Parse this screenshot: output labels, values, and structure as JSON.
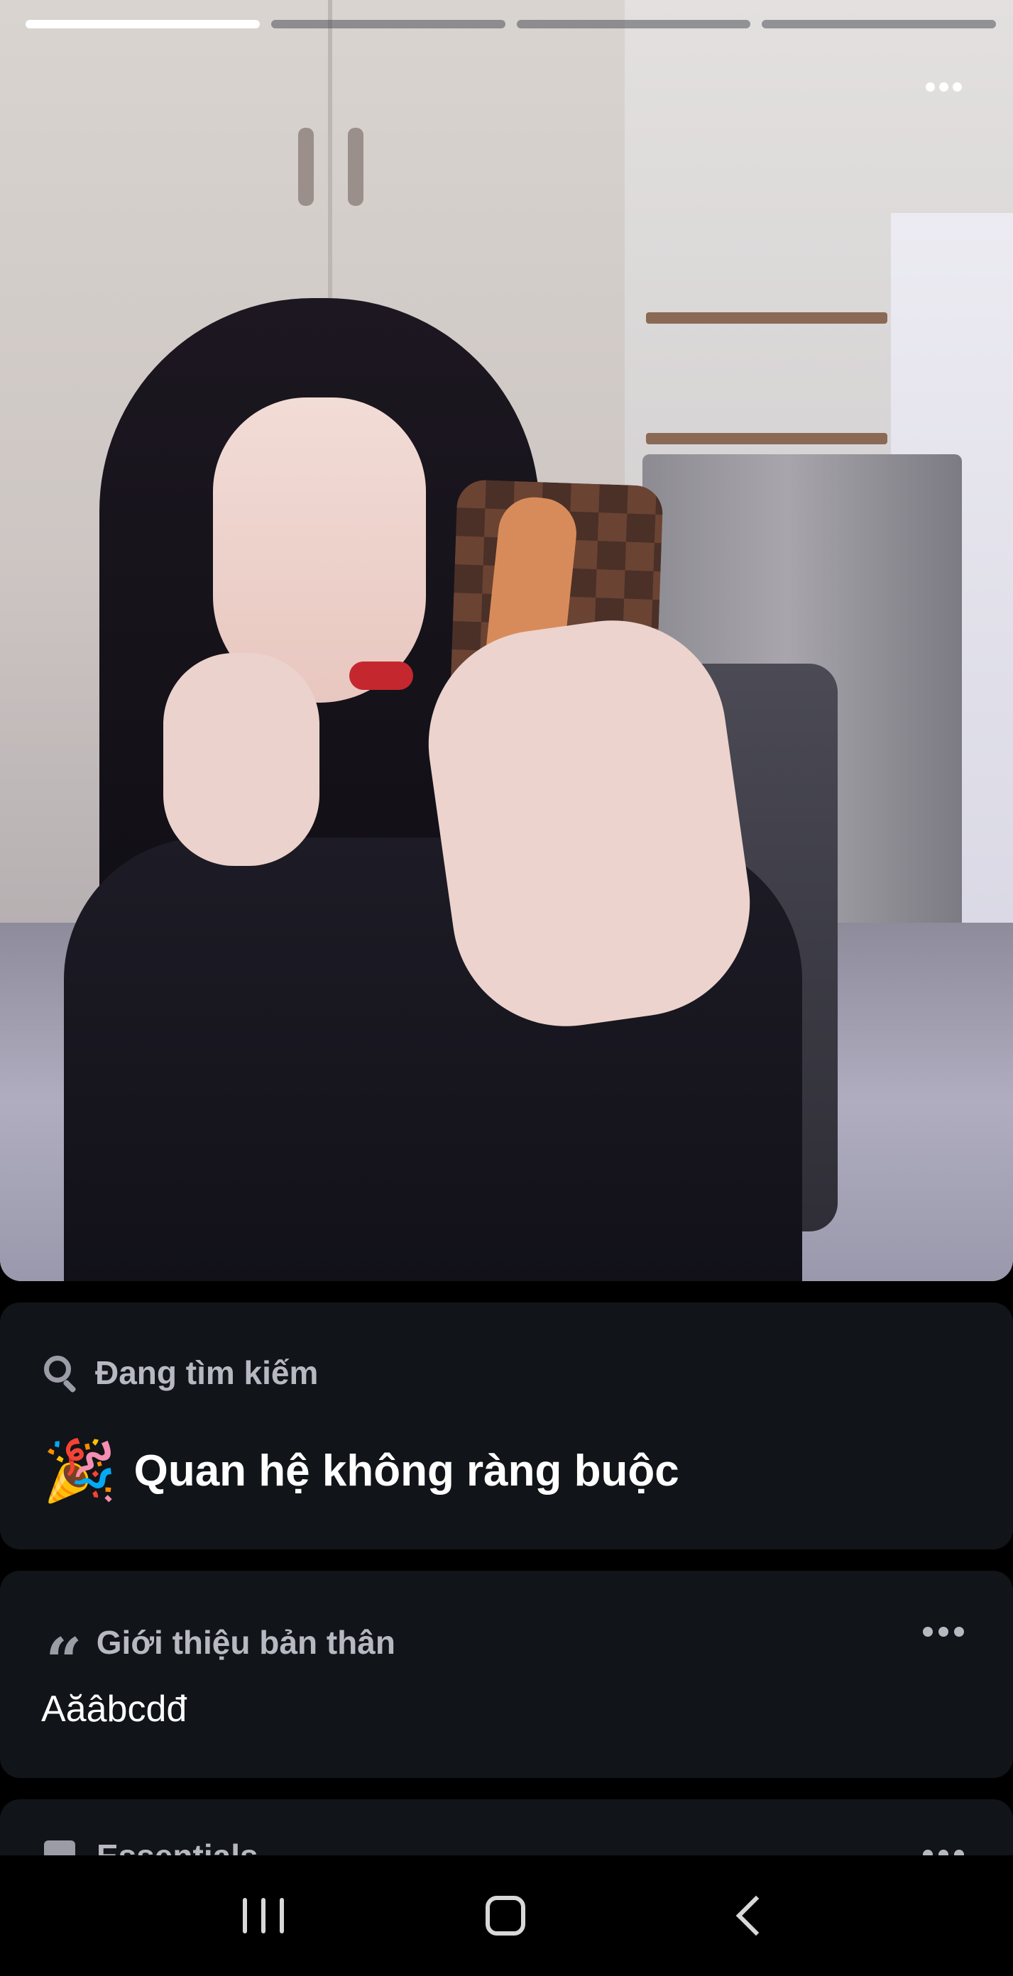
{
  "story": {
    "progress_total": 4,
    "progress_current": 1
  },
  "looking_for": {
    "label": "Đang tìm kiếm",
    "emoji": "🎉",
    "value": "Quan hệ không ràng buộc"
  },
  "bio": {
    "label": "Giới thiệu bản thân",
    "text": "Aăâbcdđ"
  },
  "essentials": {
    "label": "Essentials"
  },
  "icons": {
    "search": "search-icon",
    "quote": "quote-icon",
    "more": "more-icon",
    "person": "person-icon"
  },
  "colors": {
    "background": "#000000",
    "card": "#111418",
    "label": "#b8b8c2",
    "text": "#ffffff"
  }
}
